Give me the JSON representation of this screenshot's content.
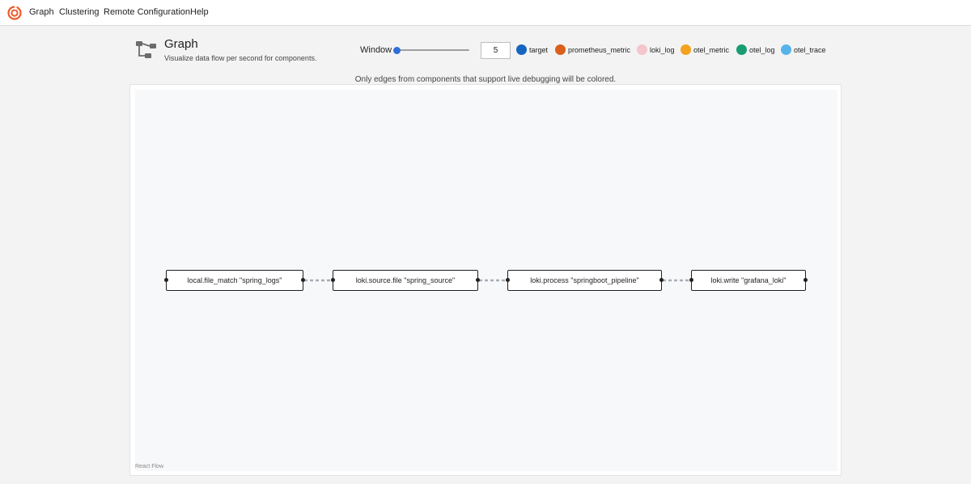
{
  "nav": {
    "items": [
      "Graph",
      "Clustering",
      "Remote Configuration",
      "Help"
    ]
  },
  "header": {
    "title": "Graph",
    "subtitle": "Visualize data flow per second for components."
  },
  "controls": {
    "window_label": "Window",
    "window_value": "5",
    "slider_fraction": 0.02
  },
  "legend": [
    {
      "label": "target",
      "color": "#1565c0"
    },
    {
      "label": "prometheus_metric",
      "color": "#d9601a"
    },
    {
      "label": "loki_log",
      "color": "#f6c4cc"
    },
    {
      "label": "otel_metric",
      "color": "#f4a11d"
    },
    {
      "label": "otel_log",
      "color": "#1a9c72"
    },
    {
      "label": "otel_trace",
      "color": "#56b4e9"
    }
  ],
  "notice": "Only edges from components that support live debugging will be colored.",
  "graph": {
    "attribution": "React Flow",
    "nodes": [
      {
        "label": "local.file_match \"spring_logs\""
      },
      {
        "label": "loki.source.file \"spring_source\""
      },
      {
        "label": "loki.process \"springboot_pipeline\""
      },
      {
        "label": "loki.write \"grafana_loki\""
      }
    ]
  }
}
